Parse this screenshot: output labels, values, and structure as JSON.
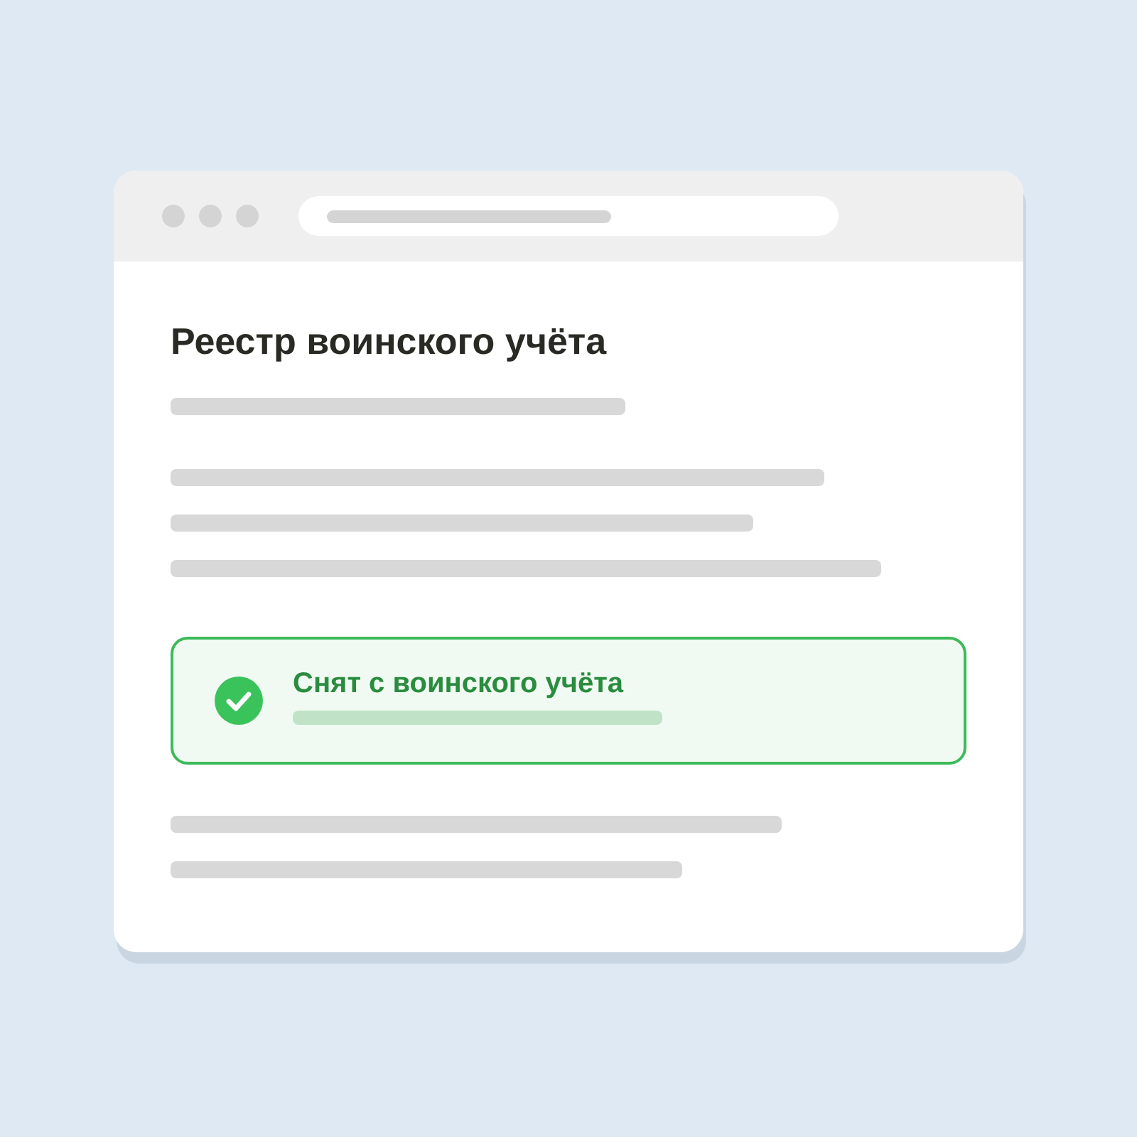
{
  "page": {
    "title": "Реестр воинского учёта"
  },
  "status_card": {
    "kind": "success",
    "text": "Снят с воинского учёта"
  }
}
